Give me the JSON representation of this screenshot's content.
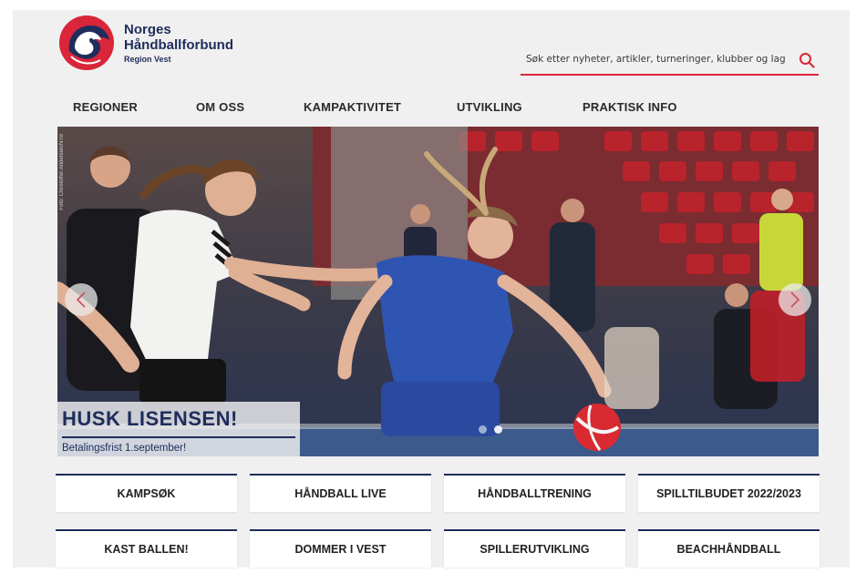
{
  "header": {
    "logo": {
      "line1": "Norges",
      "line2": "Håndballforbund",
      "line3": "Region Vest"
    },
    "search": {
      "placeholder": "Søk etter nyheter, artikler, turneringer, klubber og lag",
      "icon": "search-icon"
    }
  },
  "nav": {
    "items": [
      {
        "label": "REGIONER"
      },
      {
        "label": "OM OSS"
      },
      {
        "label": "KAMPAKTIVITET"
      },
      {
        "label": "UTVIKLING"
      },
      {
        "label": "PRAKTISK INFO"
      }
    ]
  },
  "hero": {
    "title": "HUSK LISENSEN!",
    "subtitle": "Betalingsfrist 1.september!",
    "photo_credit": "Foto: Christoffer Andersen/NTB",
    "slides_total": 2,
    "active_slide": 2
  },
  "tiles": {
    "row1": [
      {
        "label": "KAMPSØK"
      },
      {
        "label": "HÅNDBALL LIVE"
      },
      {
        "label": "HÅNDBALLTRENING"
      },
      {
        "label": "SPILLTILBUDET 2022/2023"
      }
    ],
    "row2": [
      {
        "label": "KAST BALLEN!"
      },
      {
        "label": "DOMMER I VEST"
      },
      {
        "label": "SPILLERUTVIKLING"
      },
      {
        "label": "BEACHHÅNDBALL"
      }
    ]
  },
  "colors": {
    "brand_navy": "#1e2d5c",
    "brand_red": "#d9263a",
    "page_bg": "#f0f0f0"
  }
}
